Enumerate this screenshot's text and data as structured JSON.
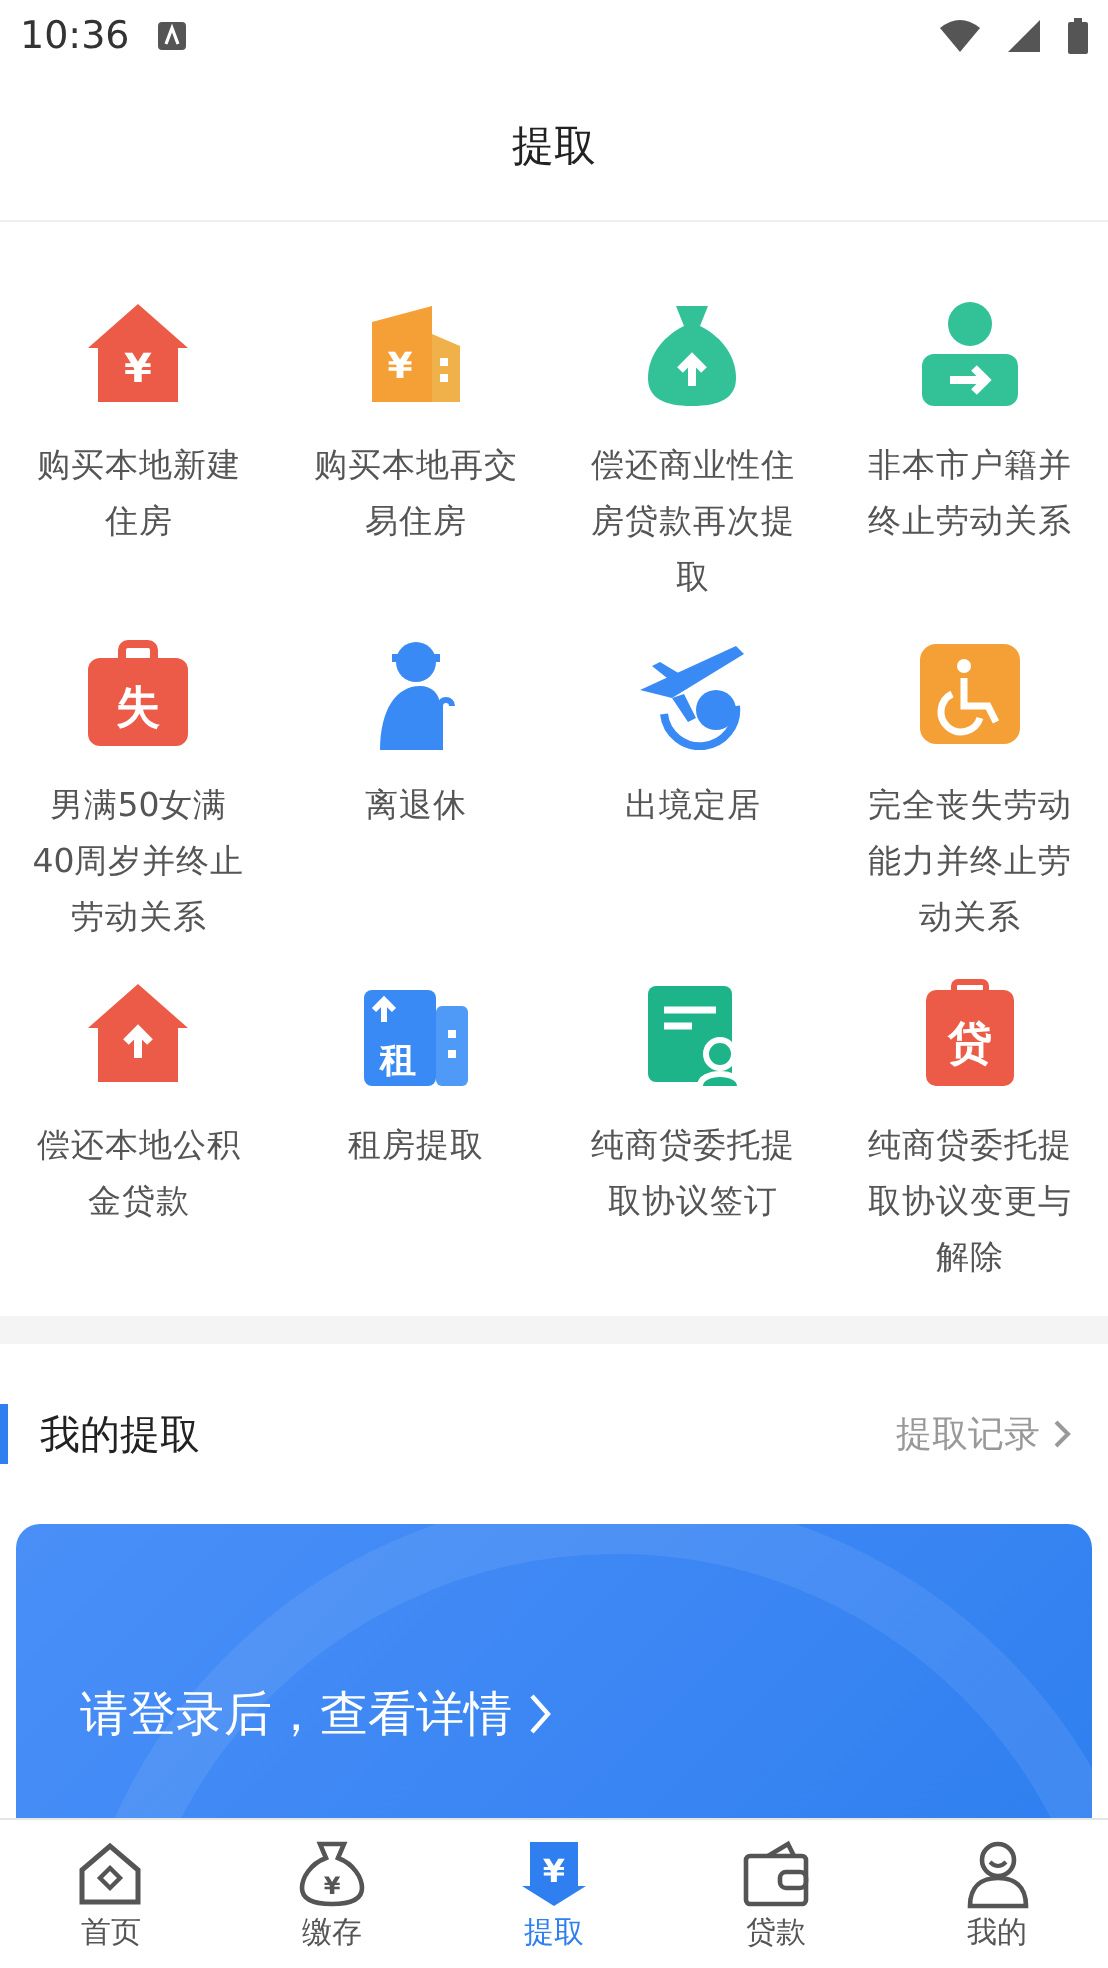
{
  "status_bar": {
    "time": "10:36"
  },
  "header": {
    "title": "提取"
  },
  "items": [
    {
      "kind": "house-yen",
      "glyph": "¥",
      "label": "购买本地新建住房"
    },
    {
      "kind": "building-yen",
      "glyph": "¥",
      "label": "购买本地再交易住房"
    },
    {
      "kind": "moneybag",
      "label": "偿还商业性住房贷款再次提取"
    },
    {
      "kind": "person-arrow",
      "label": "非本市户籍并终止劳动关系"
    },
    {
      "kind": "briefcase",
      "glyph": "失",
      "label": "男满50女满40周岁并终止劳动关系"
    },
    {
      "kind": "elder",
      "label": "离退休"
    },
    {
      "kind": "plane",
      "label": "出境定居"
    },
    {
      "kind": "wheelchair",
      "label": "完全丧失劳动能力并终止劳动关系"
    },
    {
      "kind": "house-up",
      "label": "偿还本地公积金贷款"
    },
    {
      "kind": "rent",
      "glyph": "租",
      "label": "租房提取"
    },
    {
      "kind": "contract",
      "label": "纯商贷委托提取协议签订"
    },
    {
      "kind": "clipboard",
      "glyph": "贷",
      "label": "纯商贷委托提取协议变更与解除"
    }
  ],
  "section": {
    "title": "我的提取",
    "link": "提取记录"
  },
  "login_card": {
    "text": "请登录后，查看详情"
  },
  "tabs": [
    {
      "kind": "home",
      "label": "首页",
      "selected": false
    },
    {
      "kind": "bag",
      "glyph": "¥",
      "label": "缴存",
      "selected": false
    },
    {
      "kind": "withdraw",
      "glyph": "¥",
      "label": "提取",
      "selected": true
    },
    {
      "kind": "wallet",
      "label": "贷款",
      "selected": false
    },
    {
      "kind": "user",
      "label": "我的",
      "selected": false
    }
  ]
}
